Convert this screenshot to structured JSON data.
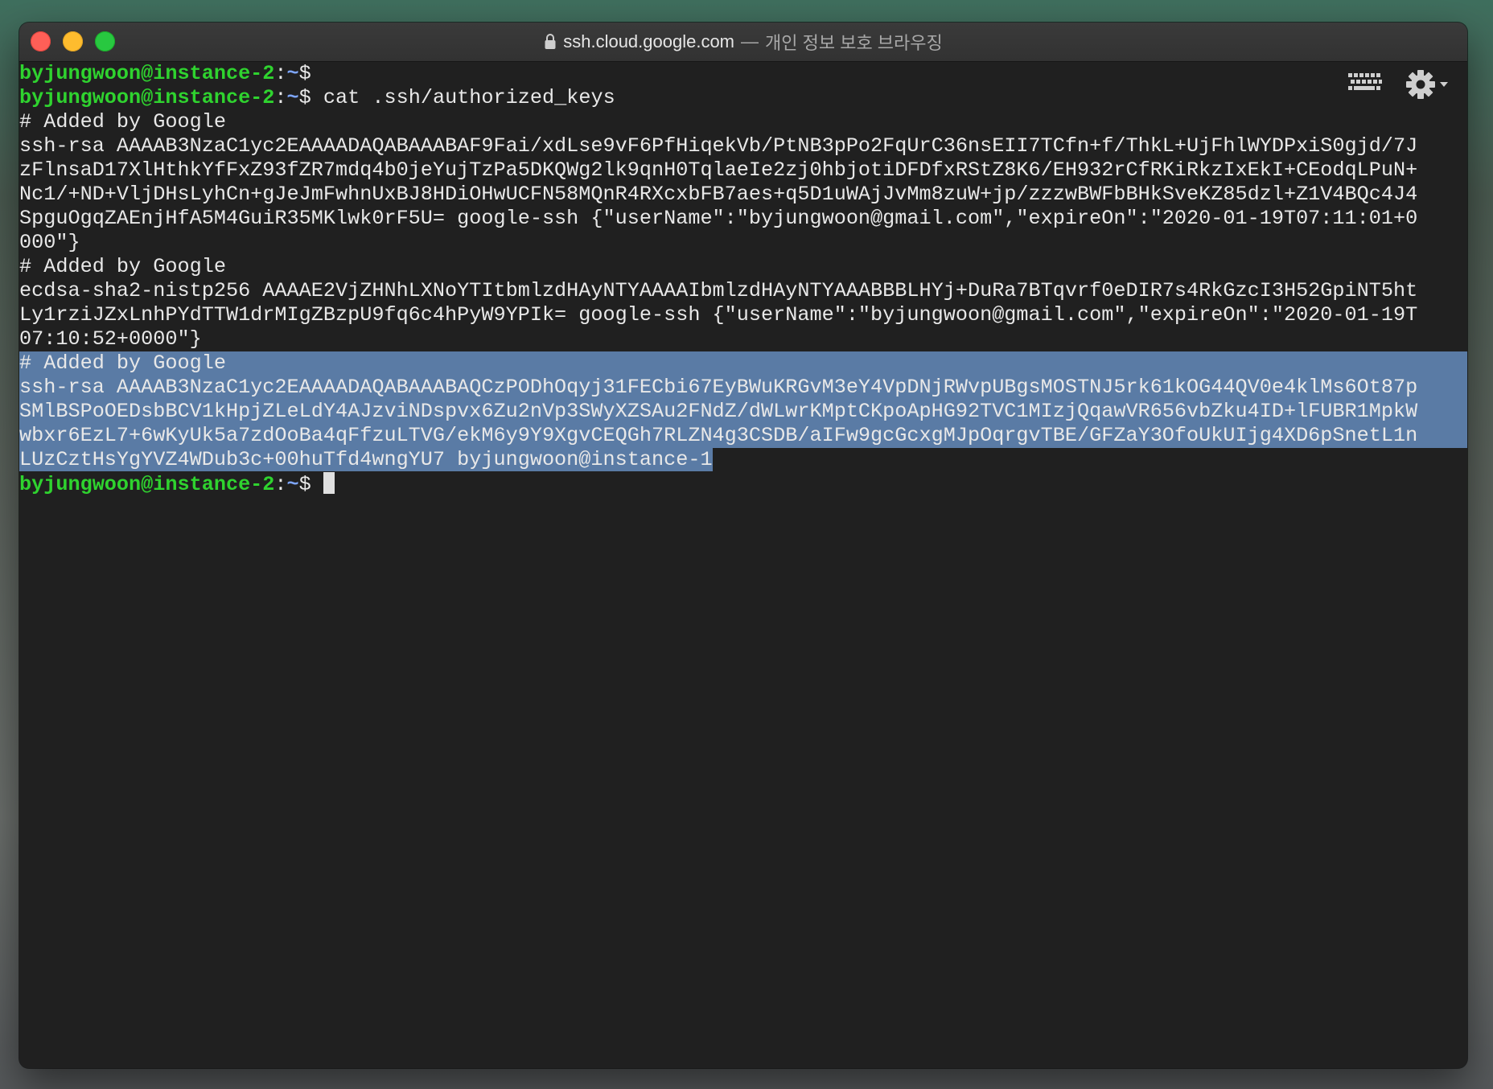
{
  "window": {
    "host": "ssh.cloud.google.com",
    "separator": "—",
    "private_label": "개인 정보 보호 브라우징"
  },
  "prompt": {
    "user": "byjungwoon@instance-2",
    "colon": ":",
    "path": "~",
    "dollar": "$"
  },
  "command": "cat .ssh/authorized_keys",
  "output": {
    "block1": [
      "# Added by Google",
      "ssh-rsa AAAAB3NzaC1yc2EAAAADAQABAAABAF9Fai/xdLse9vF6PfHiqekVb/PtNB3pPo2FqUrC36nsEII7TCfn+f/ThkL+UjFhlWYDPxiS0gjd/7J",
      "zFlnsaD17XlHthkYfFxZ93fZR7mdq4b0jeYujTzPa5DKQWg2lk9qnH0TqlaeIe2zj0hbjotiDFDfxRStZ8K6/EH932rCfRKiRkzIxEkI+CEodqLPuN+",
      "Nc1/+ND+VljDHsLyhCn+gJeJmFwhnUxBJ8HDiOHwUCFN58MQnR4RXcxbFB7aes+q5D1uWAjJvMm8zuW+jp/zzzwBWFbBHkSveKZ85dzl+Z1V4BQc4J4",
      "SpguOgqZAEnjHfA5M4GuiR35MKlwk0rF5U= google-ssh {\"userName\":\"byjungwoon@gmail.com\",\"expireOn\":\"2020-01-19T07:11:01+0",
      "000\"}"
    ],
    "block2": [
      "# Added by Google",
      "ecdsa-sha2-nistp256 AAAAE2VjZHNhLXNoYTItbmlzdHAyNTYAAAAIbmlzdHAyNTYAAABBBLHYj+DuRa7BTqvrf0eDIR7s4RkGzcI3H52GpiNT5ht",
      "Ly1rziJZxLnhPYdTTW1drMIgZBzpU9fq6c4hPyW9YPIk= google-ssh {\"userName\":\"byjungwoon@gmail.com\",\"expireOn\":\"2020-01-19T",
      "07:10:52+0000\"}"
    ],
    "block3_selected": [
      "# Added by Google",
      "ssh-rsa AAAAB3NzaC1yc2EAAAADAQABAAABAQCzPODhOqyj31FECbi67EyBWuKRGvM3eY4VpDNjRWvpUBgsMOSTNJ5rk61kOG44QV0e4klMs6Ot87p",
      "SMlBSPoOEDsbBCV1kHpjZLeLdY4AJzviNDspvx6Zu2nVp3SWyXZSAu2FNdZ/dWLwrKMptCKpoApHG92TVC1MIzjQqawVR656vbZku4ID+lFUBR1MpkW",
      "wbxr6EzL7+6wKyUk5a7zdOoBa4qFfzuLTVG/ekM6y9Y9XgvCEQGh7RLZN4g3CSDB/aIFw9gcGcxgMJpOqrgvTBE/GFZaY3OfoUkUIjg4XD6pSnetL1n",
      "LUzCztHsYgYVZ4WDub3c+00huTfd4wngYU7 byjungwoon@instance-1"
    ]
  },
  "colors": {
    "prompt_user": "#2fd32f",
    "prompt_path": "#7ea6ff",
    "selection": "#5a7ba5",
    "terminal_bg": "#202020"
  },
  "icons": {
    "keyboard": "keyboard-icon",
    "settings": "gear-icon"
  }
}
